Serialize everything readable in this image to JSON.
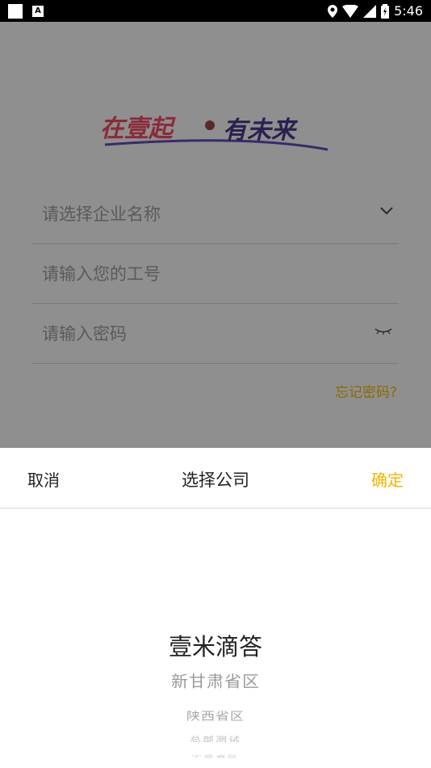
{
  "status_bar": {
    "time": "5:46"
  },
  "login": {
    "logo_text": "在壹起 有未来",
    "company_placeholder": "请选择企业名称",
    "employee_id_placeholder": "请输入您的工号",
    "password_placeholder": "请输入密码",
    "forgot_password": "忘记密码?"
  },
  "sheet": {
    "cancel": "取消",
    "title": "选择公司",
    "confirm": "确定",
    "options": [
      "壹米滴答",
      "新甘肃省区",
      "陕西省区",
      "总部测试",
      "宁夏省区"
    ]
  },
  "colors": {
    "accent": "#f2b400",
    "overlay": "#8f8f8f"
  }
}
